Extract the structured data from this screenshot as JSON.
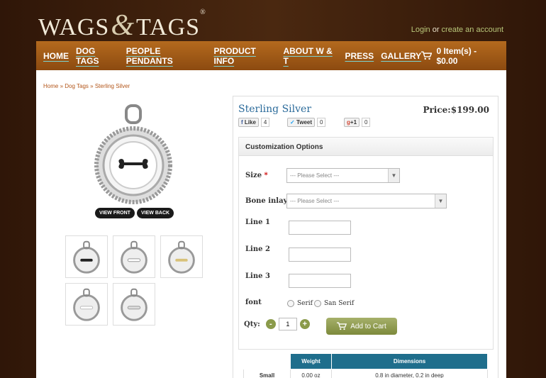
{
  "logo": {
    "left": "WAGS",
    "amp": "&",
    "right": "TAGS",
    "reg": "®"
  },
  "account": {
    "login": "Login",
    "or": "or",
    "create": "create an account"
  },
  "nav": {
    "items": [
      "HOME",
      "DOG TAGS",
      "PEOPLE PENDANTS",
      "PRODUCT INFO",
      "ABOUT W & T",
      "PRESS",
      "GALLERY"
    ],
    "cart": "0 Item(s) - $0.00"
  },
  "breadcrumb": {
    "home": "Home",
    "sep": "»",
    "cat": "Dog Tags",
    "current": "Sterling Silver"
  },
  "gallery": {
    "view_front": "VIEW FRONT",
    "view_back": "VIEW BACK"
  },
  "product": {
    "title": "Sterling Silver",
    "price": "Price:$199.00",
    "social": {
      "like": "Like",
      "like_count": "4",
      "tweet": "Tweet",
      "tweet_count": "0",
      "plus": "+1",
      "plus_count": "0"
    }
  },
  "options": {
    "heading": "Customization Options",
    "size_label": "Size",
    "bone_label": "Bone inlay",
    "select_placeholder": "--- Please Select ---",
    "line1": "Line 1",
    "line2": "Line 2",
    "line3": "Line 3",
    "font_label": "font",
    "font_opts": [
      "Serif",
      "San Serif"
    ]
  },
  "purchase": {
    "qty_label": "Qty:",
    "minus": "-",
    "qty": "1",
    "plus": "+",
    "add_to_cart": "Add to Cart"
  },
  "spec": {
    "headers": [
      "",
      "Weight",
      "Dimensions"
    ],
    "row": [
      "Small",
      "0.00 oz",
      "0.8 in diameter, 0.2 in deep"
    ]
  },
  "colors": {
    "nav_bg": "#9c5816",
    "accent": "#2a6a9a",
    "header_teal": "#1f6e8c"
  }
}
